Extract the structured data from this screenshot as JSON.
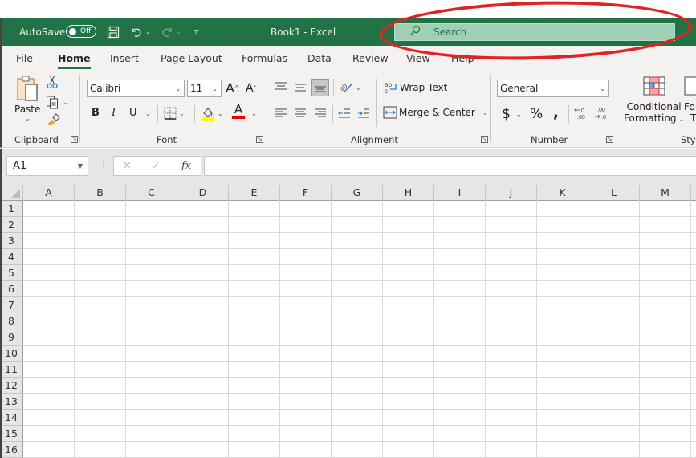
{
  "titlebar": {
    "autosave_label": "AutoSave",
    "autosave_state": "Off",
    "window_title": "Book1  -  Excel",
    "search_placeholder": "Search",
    "accent_color": "#217346"
  },
  "menu": {
    "tabs": [
      {
        "label": "File"
      },
      {
        "label": "Home",
        "active": true
      },
      {
        "label": "Insert"
      },
      {
        "label": "Page Layout"
      },
      {
        "label": "Formulas"
      },
      {
        "label": "Data"
      },
      {
        "label": "Review"
      },
      {
        "label": "View"
      },
      {
        "label": "Help"
      }
    ]
  },
  "ribbon": {
    "clipboard": {
      "label": "Clipboard",
      "paste_label": "Paste"
    },
    "font": {
      "label": "Font",
      "font_name": "Calibri",
      "font_size": "11",
      "bold": "B",
      "italic": "I",
      "underline": "U",
      "font_color": "A"
    },
    "alignment": {
      "label": "Alignment",
      "wrap_text": "Wrap Text",
      "merge_center": "Merge & Center"
    },
    "number": {
      "label": "Number",
      "format": "General",
      "currency": "$",
      "percent": "%",
      "comma": ")"
    },
    "styles": {
      "label": "Styl",
      "conditional_formatting_line1": "Conditional",
      "conditional_formatting_line2": "Formatting",
      "format_table_line1": "Fo",
      "format_table_line2": "T"
    }
  },
  "formula_bar": {
    "name_box": "A1",
    "cancel": "✕",
    "enter": "✓",
    "fx": "fx",
    "formula_value": ""
  },
  "grid": {
    "columns": [
      "A",
      "B",
      "C",
      "D",
      "E",
      "F",
      "G",
      "H",
      "I",
      "J",
      "K",
      "L",
      "M"
    ],
    "rows": [
      "1",
      "2",
      "3",
      "4",
      "5",
      "6",
      "7",
      "8",
      "9",
      "10",
      "11",
      "12",
      "13",
      "14",
      "15",
      "16"
    ]
  },
  "annotation": {
    "color": "#e32222",
    "target": "search-box"
  }
}
